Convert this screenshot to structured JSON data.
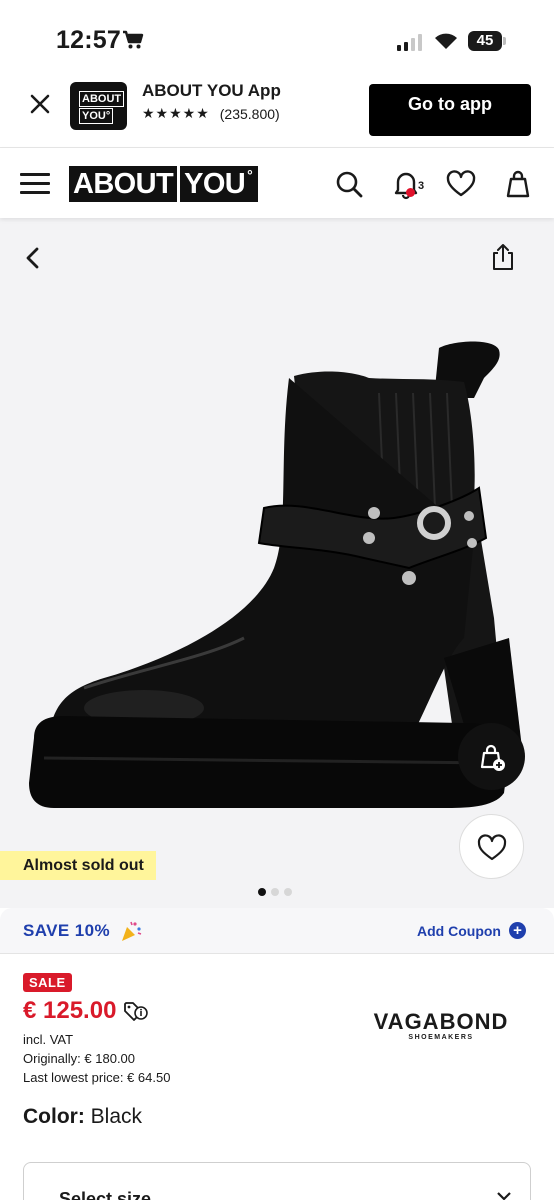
{
  "status": {
    "time": "12:57",
    "battery": "45"
  },
  "banner": {
    "title": "ABOUT YOU App",
    "stars": "★★★★★",
    "rating_count": "(235.800)",
    "cta": "Go to app",
    "logo_line1": "ABOUT",
    "logo_line2": "YOU°"
  },
  "header": {
    "logo_left": "ABOUT",
    "logo_right": "YOU",
    "notification_count": "3"
  },
  "gallery": {
    "badge": "Almost sold out",
    "dots": 3,
    "active_dot": 0
  },
  "coupon": {
    "save": "SAVE 10%",
    "add": "Add Coupon"
  },
  "price": {
    "sale_label": "SALE",
    "current": "€ 125.00",
    "vat": "incl. VAT",
    "original": "Originally: € 180.00",
    "lowest": "Last lowest price: € 64.50"
  },
  "brand": {
    "name": "VAGABOND",
    "sub": "SHOEMAKERS"
  },
  "color": {
    "label": "Color:",
    "value": "Black"
  },
  "size": {
    "label": "Select size"
  },
  "colors": {
    "accent_blue": "#1f3fad",
    "sale_red": "#d91a2a",
    "badge_yellow": "#fff59b"
  }
}
